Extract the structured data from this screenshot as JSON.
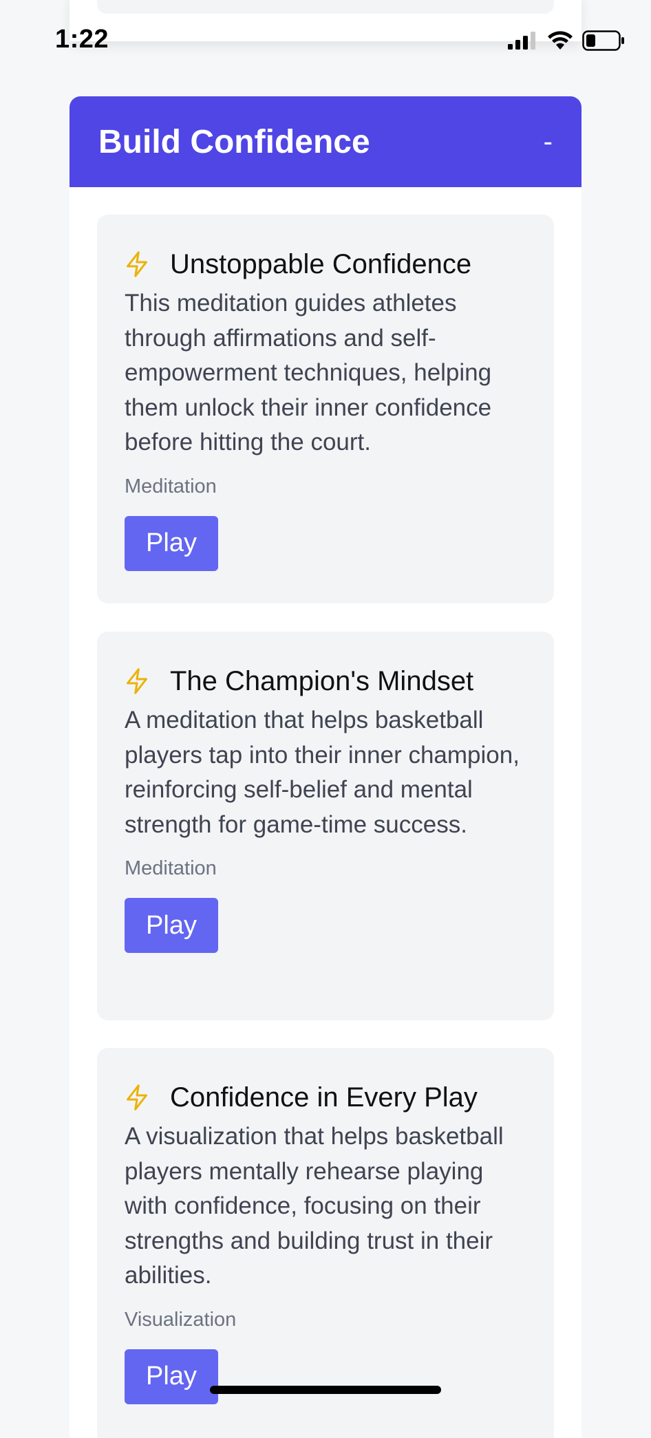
{
  "status_bar": {
    "time": "1:22",
    "icons": [
      "signal-icon",
      "wifi-icon",
      "battery-icon"
    ]
  },
  "section": {
    "title": "Build Confidence",
    "toggle_label": "-",
    "header_color": "#4f46e5"
  },
  "cards": [
    {
      "icon": "bolt-icon",
      "title": "Unstoppable Confidence",
      "description": "This meditation guides athletes through affirmations and self-empowerment techniques, helping them unlock their inner confidence before hitting the court.",
      "type": "Meditation",
      "button_label": "Play"
    },
    {
      "icon": "bolt-icon",
      "title": "The Champion's Mindset",
      "description": "A meditation that helps basketball players tap into their inner champion, reinforcing self-belief and mental strength for game-time success.",
      "type": "Meditation",
      "button_label": "Play"
    },
    {
      "icon": "bolt-icon",
      "title": "Confidence in Every Play",
      "description": "A visualization that helps basketball players mentally rehearse playing with confidence, focusing on their strengths and building trust in their abilities.",
      "type": "Visualization",
      "button_label": "Play"
    }
  ],
  "colors": {
    "accent": "#6366f1",
    "icon": "#eab308",
    "background": "#f6f7f9",
    "card": "#f3f4f6"
  }
}
